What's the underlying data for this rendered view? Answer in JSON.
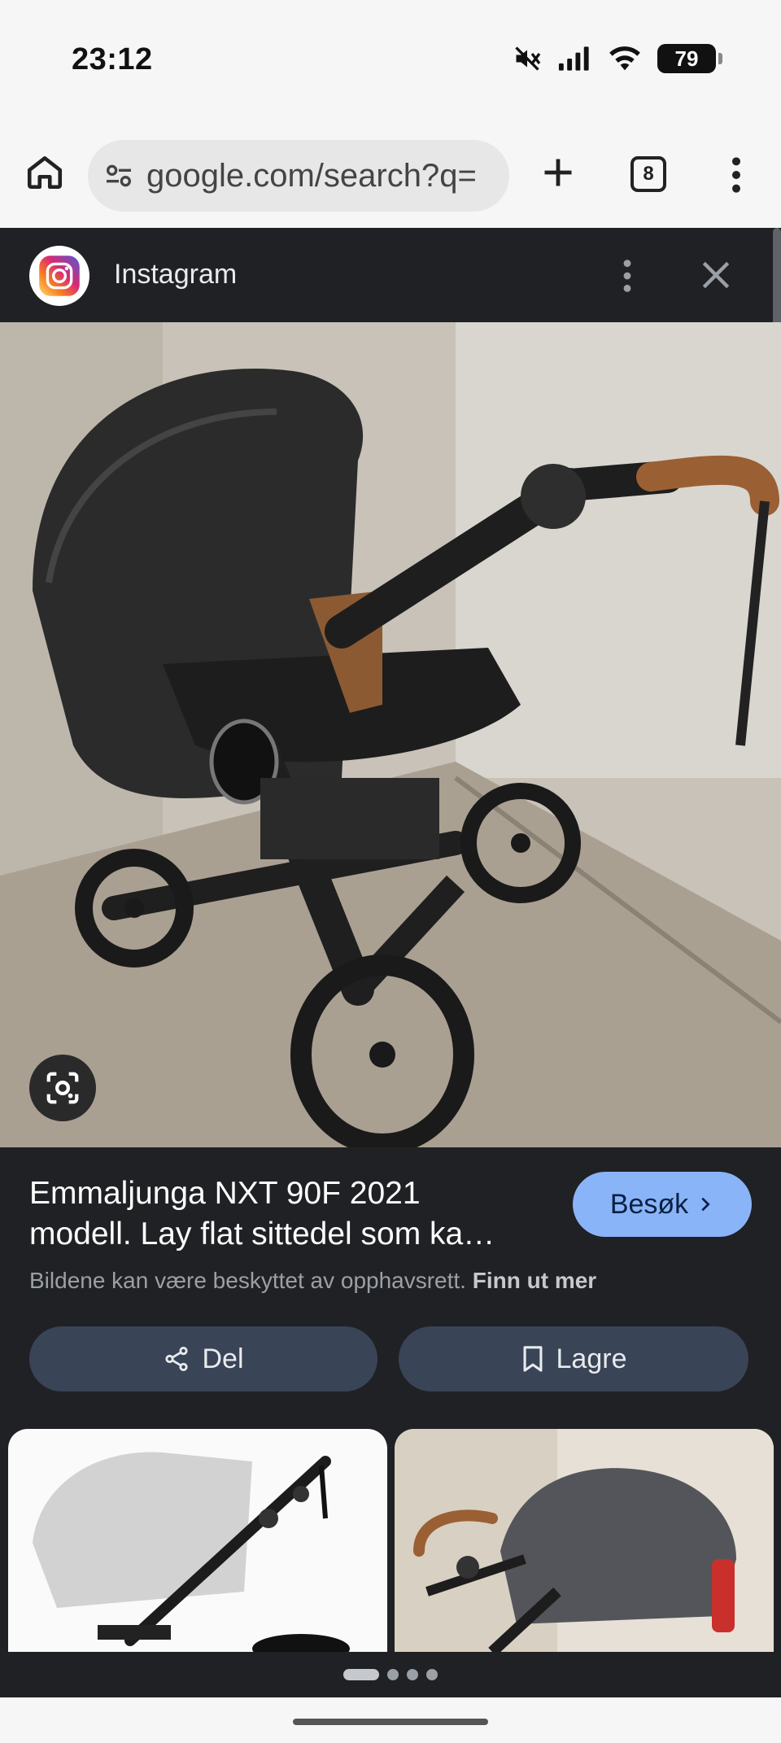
{
  "status_bar": {
    "time": "23:12",
    "battery": "79",
    "icons": [
      "mute-icon",
      "signal-icon",
      "wifi-icon",
      "battery-icon"
    ]
  },
  "browser": {
    "url": "google.com/search?q=",
    "tab_count": "8"
  },
  "source": {
    "name": "Instagram"
  },
  "result": {
    "title_line1": "Emmaljunga NXT 90F 2021",
    "title_line2": "modell. Lay flat sittedel som ka…",
    "visit_label": "Besøk",
    "copyright_text": "Bildene kan være beskyttet av opphavsrett.",
    "learn_more": "Finn ut mer",
    "share_label": "Del",
    "save_label": "Lagre"
  },
  "pager": {
    "pages": 4,
    "active_index": 0
  },
  "colors": {
    "panel_bg": "#202124",
    "accent": "#8ab4f8",
    "action_bg": "#394457"
  }
}
